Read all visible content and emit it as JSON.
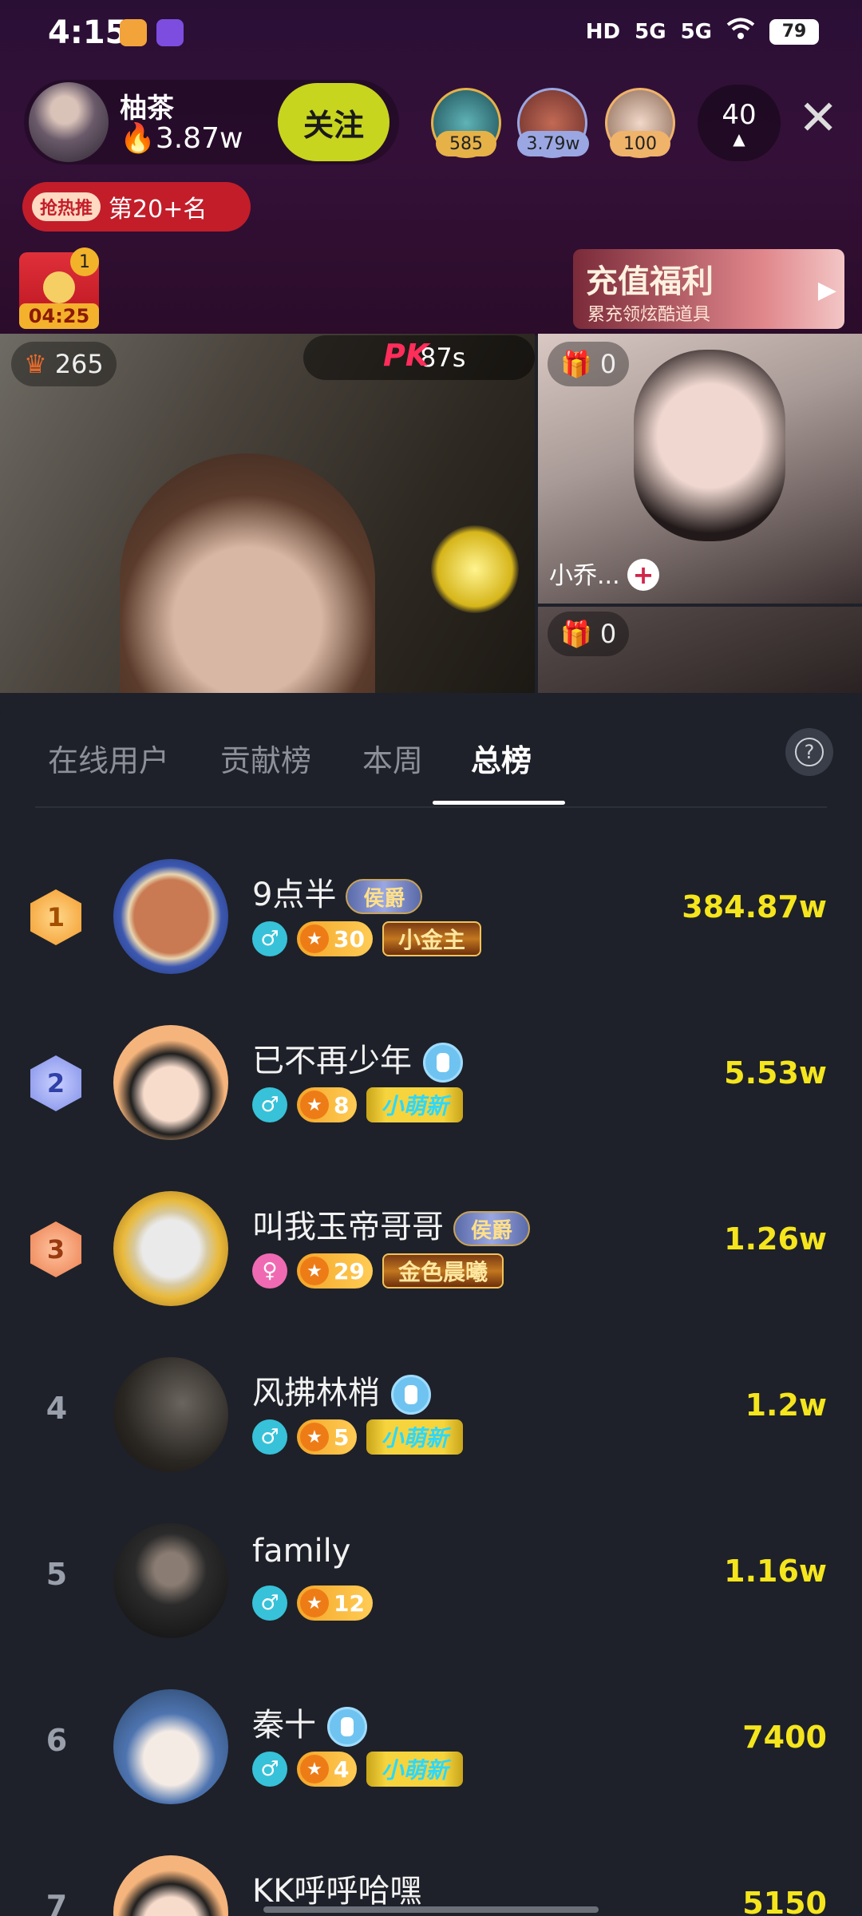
{
  "status_bar": {
    "time": "4:15",
    "network1": "5G",
    "network2": "5G",
    "hd": "HD",
    "battery": "79"
  },
  "anchor": {
    "name": "柚茶",
    "heat": "3.87w",
    "follow_label": "关注"
  },
  "viewers": [
    {
      "badge": "585",
      "badge_color": "#e6b248"
    },
    {
      "badge": "3.79w",
      "badge_color": "#9aa7e2"
    },
    {
      "badge": "100",
      "badge_color": "#f0b36a"
    }
  ],
  "viewer_count": "40",
  "hot_rank": {
    "tag": "抢热推",
    "text": "第20+名"
  },
  "redpack": {
    "count": "1",
    "timer": "04:25"
  },
  "recharge": {
    "title": "充值福利",
    "subtitle": "累充领炫酷道具"
  },
  "pk": {
    "main_gift": "265",
    "timer": "87s",
    "logo": "PK",
    "side1_gift": "0",
    "side1_name": "小乔...",
    "side2_gift": "0"
  },
  "tabs": [
    {
      "label": "在线用户"
    },
    {
      "label": "贡献榜"
    },
    {
      "label": "本周"
    },
    {
      "label": "总榜"
    }
  ],
  "help_icon": "?",
  "ranking": [
    {
      "rank": "1",
      "name": "9点半",
      "name_badge": "侯爵",
      "gender": "♂",
      "level": "30",
      "title": "小金主",
      "title_style": "gold",
      "score": "384.87w"
    },
    {
      "rank": "2",
      "name": "已不再少年",
      "name_badge": "",
      "gender": "♂",
      "level": "8",
      "title": "小萌新",
      "title_style": "new",
      "score": "5.53w"
    },
    {
      "rank": "3",
      "name": "叫我玉帝哥哥",
      "name_badge": "侯爵",
      "gender": "♀",
      "level": "29",
      "title": "金色晨曦",
      "title_style": "gold",
      "score": "1.26w"
    },
    {
      "rank": "4",
      "name": "风拂林梢",
      "name_badge": "",
      "gender": "♂",
      "level": "5",
      "title": "小萌新",
      "title_style": "new",
      "score": "1.2w"
    },
    {
      "rank": "5",
      "name": "family",
      "name_badge": "",
      "gender": "♂",
      "level": "12",
      "title": "",
      "title_style": "",
      "score": "1.16w"
    },
    {
      "rank": "6",
      "name": "秦十",
      "name_badge": "",
      "gender": "♂",
      "level": "4",
      "title": "小萌新",
      "title_style": "new",
      "score": "7400"
    },
    {
      "rank": "7",
      "name": "KK呼呼哈嘿",
      "name_badge": "",
      "gender": "♂",
      "level": "",
      "title": "",
      "title_style": "",
      "score": "5150"
    }
  ]
}
